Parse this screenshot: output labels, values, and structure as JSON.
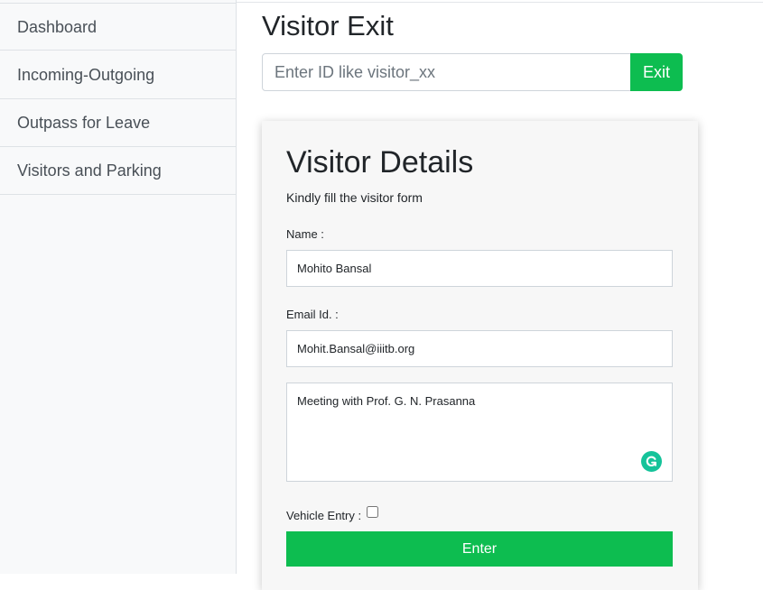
{
  "sidebar": {
    "items": [
      {
        "label": "Dashboard"
      },
      {
        "label": "Incoming-Outgoing"
      },
      {
        "label": "Outpass for Leave"
      },
      {
        "label": "Visitors and Parking"
      }
    ]
  },
  "exit": {
    "title": "Visitor Exit",
    "placeholder": "Enter ID like visitor_xx",
    "button_label": "Exit"
  },
  "form": {
    "title": "Visitor Details",
    "subtitle": "Kindly fill the visitor form",
    "name_label": "Name :",
    "name_value": "Mohito Bansal",
    "email_label": "Email Id. :",
    "email_value": "Mohit.Bansal@iiitb.org",
    "purpose_value": "Meeting with Prof. G. N. Prasanna",
    "vehicle_label": "Vehicle Entry :",
    "vehicle_checked": false,
    "submit_label": "Enter"
  },
  "colors": {
    "accent_green": "#0dbd50",
    "grammarly_green": "#15c39a"
  },
  "icons": [
    "grammarly-icon"
  ]
}
